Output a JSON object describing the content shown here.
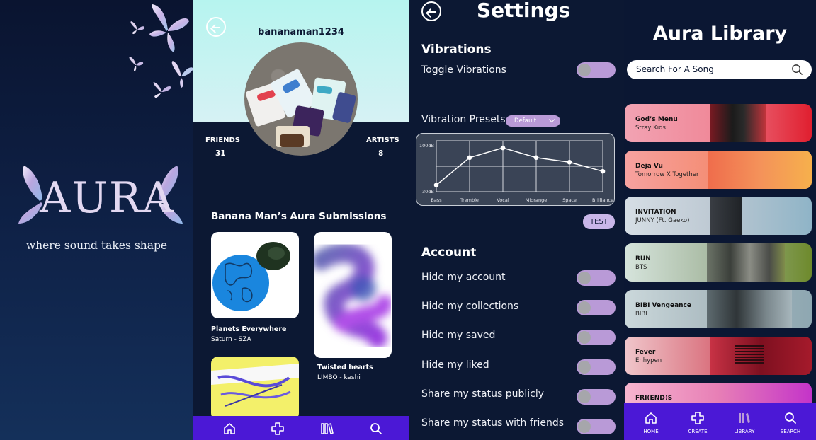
{
  "splash": {
    "logo_text": "AURA",
    "tagline": "where sound takes shape"
  },
  "profile": {
    "username": "bananaman1234",
    "friends_label": "FRIENDS",
    "friends_count": "31",
    "artists_label": "ARTISTS",
    "artists_count": "8",
    "submissions_title": "Banana Man’s Aura Submissions",
    "submissions": [
      {
        "title": "Planets Everywhere",
        "subtitle": "Saturn - SZA"
      },
      {
        "title": "Twisted hearts",
        "subtitle": "LIMBO - keshi"
      },
      {
        "title": "",
        "subtitle": ""
      }
    ],
    "nav_icons": [
      "home-icon",
      "create-icon",
      "library-icon",
      "search-icon"
    ],
    "nav_color": "#4b18d6"
  },
  "settings": {
    "title": "Settings",
    "vibrations_heading": "Vibrations",
    "toggle_vibrations": "Toggle Vibrations",
    "presets_label": "Vibration Presets",
    "preset_value": "Default",
    "eq": {
      "y_max_label": "100dB",
      "y_min_label": "30dB",
      "bands": [
        "Bass",
        "Tremble",
        "Vocal",
        "Midrange",
        "Space",
        "Brilliance"
      ],
      "levels": [
        0.13,
        0.67,
        0.86,
        0.67,
        0.58,
        0.4
      ]
    },
    "test_label": "TEST",
    "account_heading": "Account",
    "account_rows": [
      "Hide my account",
      "Hide my collections",
      "Hide my saved",
      "Hide my liked",
      "Share my status publicly",
      "Share my status with friends"
    ],
    "toggle_color": "#b99ad7"
  },
  "library": {
    "title": "Aura Library",
    "search_placeholder": "Search For A Song",
    "songs": [
      {
        "title": "God’s Menu",
        "artist": "Stray Kids"
      },
      {
        "title": "Deja Vu",
        "artist": "Tomorrow X Together"
      },
      {
        "title": "INVITATION",
        "artist": "JUNNY (Ft. Gaeko)"
      },
      {
        "title": "RUN",
        "artist": "BTS"
      },
      {
        "title": "BIBI Vengeance",
        "artist": "BIBI"
      },
      {
        "title": "Fever",
        "artist": "Enhypen"
      },
      {
        "title": "FRI(END)S",
        "artist": ""
      }
    ],
    "nav": [
      {
        "label": "HOME",
        "icon": "home-icon"
      },
      {
        "label": "CREATE",
        "icon": "create-icon"
      },
      {
        "label": "LIBRARY",
        "icon": "library-icon"
      },
      {
        "label": "SEARCH",
        "icon": "search-icon"
      }
    ]
  }
}
